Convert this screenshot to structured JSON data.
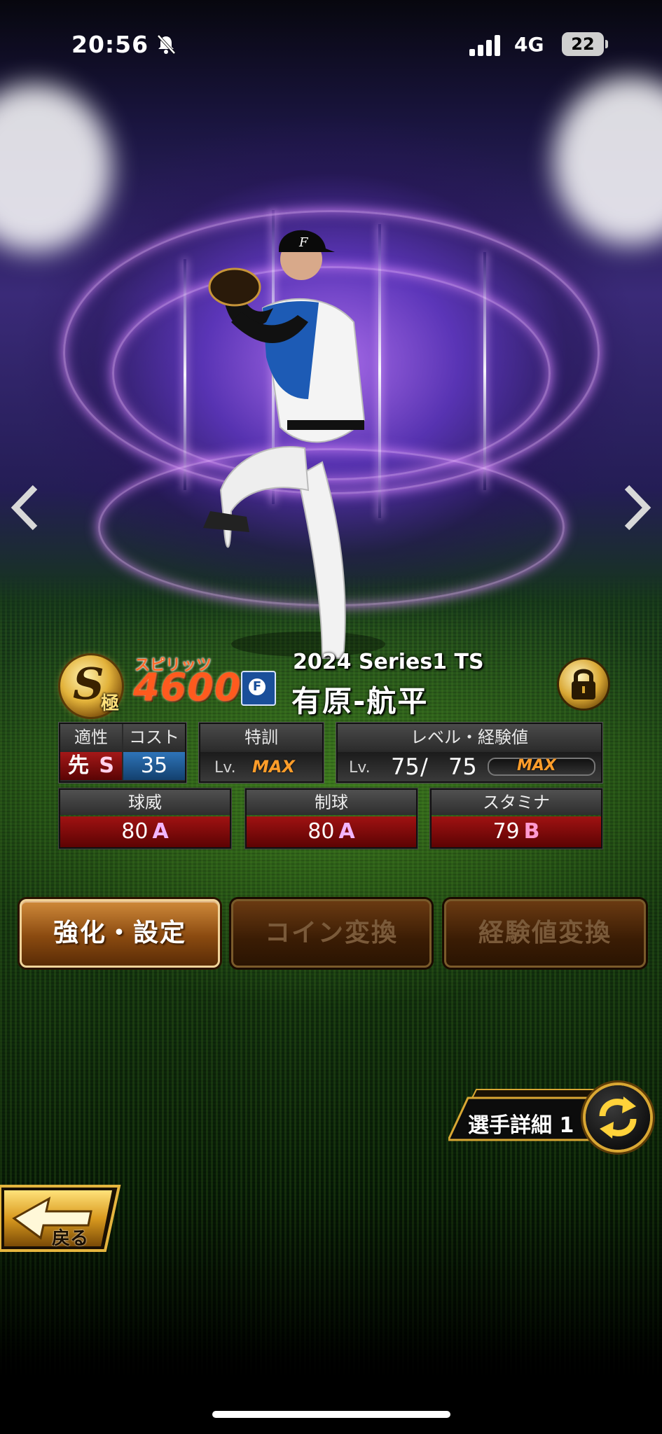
{
  "status_bar": {
    "time": "20:56",
    "network": "4G",
    "battery": "22"
  },
  "card": {
    "rank": "S",
    "rank_sub": "極",
    "spirits_label": "スピリッツ",
    "spirits_value": "4600",
    "team_logo": "F",
    "series": "2024 Series1 TS",
    "name": "有原-航平"
  },
  "info": {
    "aptitude_label": "適性",
    "aptitude_value": "先",
    "aptitude_grade": "S",
    "cost_label": "コスト",
    "cost_value": "35",
    "training_label": "特訓",
    "training_lv": "Lv.",
    "training_value": "MAX",
    "level_label": "レベル・経験値",
    "level_lv": "Lv.",
    "level_current": "75",
    "level_sep": "/",
    "level_max": "75",
    "exp_value": "MAX"
  },
  "stats": [
    {
      "label": "球威",
      "value": "80",
      "grade": "A",
      "grade_color": "#f2b6ff"
    },
    {
      "label": "制球",
      "value": "80",
      "grade": "A",
      "grade_color": "#f2b6ff"
    },
    {
      "label": "スタミナ",
      "value": "79",
      "grade": "B",
      "grade_color": "#ff9ad0"
    }
  ],
  "buttons": {
    "enhance": "強化・設定",
    "coin": "コイン変換",
    "exp": "経験値変換"
  },
  "detail": {
    "label": "選手詳細 1"
  },
  "back": {
    "label": "戻る"
  },
  "colors": {
    "accent_orange": "#ff5a1e",
    "gold": "#d9a733",
    "stat_red": "#a01212",
    "cost_blue": "#1f5f9a",
    "aptitude_red": "#8a1010"
  }
}
